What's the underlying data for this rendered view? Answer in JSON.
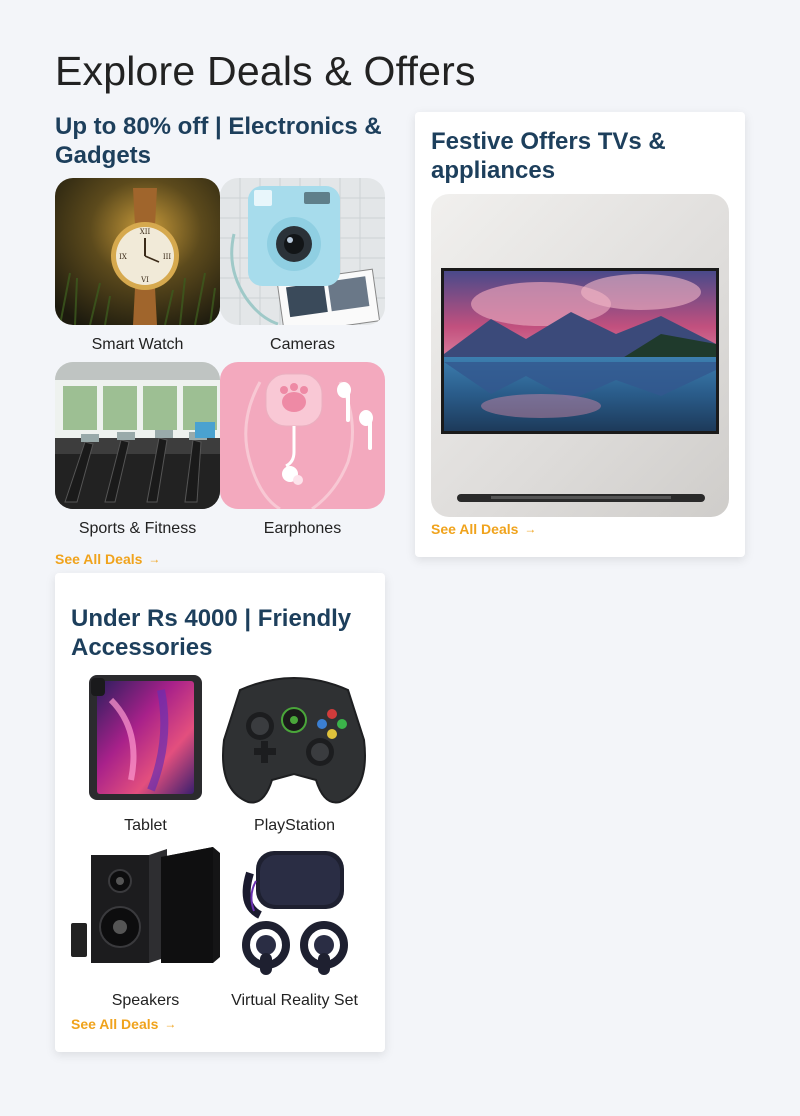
{
  "page": {
    "title": "Explore Deals & Offers"
  },
  "electronics": {
    "heading": "Up to 80% off | Electronics & Gadgets",
    "items": [
      {
        "label": "Smart Watch",
        "icon": "watch-image"
      },
      {
        "label": "Cameras",
        "icon": "instant-camera-image"
      },
      {
        "label": "Sports & Fitness",
        "icon": "treadmill-image"
      },
      {
        "label": "Earphones",
        "icon": "earphones-image"
      }
    ],
    "see_all": "See All Deals",
    "arrow": "→"
  },
  "festive": {
    "heading": "Festive Offers TVs & appliances",
    "see_all": "See All Deals",
    "arrow": "→"
  },
  "accessories": {
    "heading": "Under Rs 4000 | Friendly Accessories",
    "items": [
      {
        "label": "Tablet",
        "icon": "tablet-image"
      },
      {
        "label": "PlayStation",
        "icon": "gamepad-image"
      },
      {
        "label": "Speakers",
        "icon": "speakers-image"
      },
      {
        "label": "Virtual Reality Set",
        "icon": "vr-headset-image"
      }
    ],
    "see_all": "See All Deals",
    "arrow": "→"
  },
  "colors": {
    "heading": "#1d3f5c",
    "link": "#f0a31c",
    "background": "#f3f5f9"
  }
}
